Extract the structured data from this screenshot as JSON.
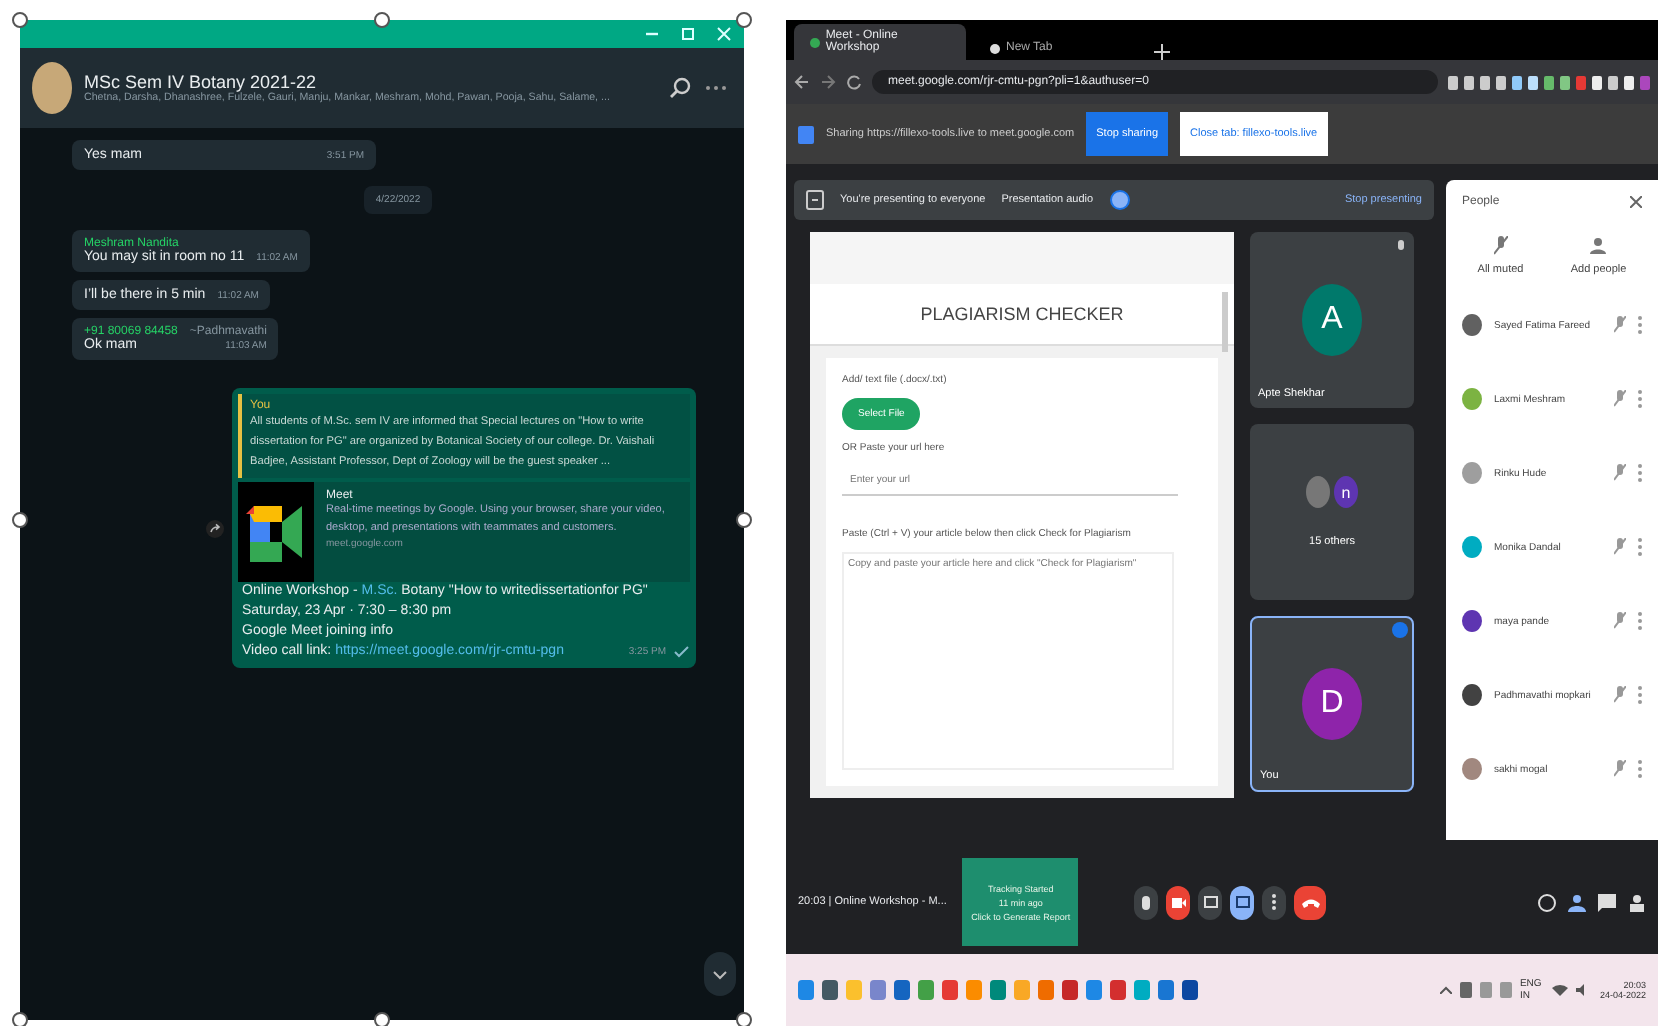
{
  "chat": {
    "group_name": "MSc Sem IV Botany 2021-22",
    "members": "Chetna, Darsha, Dhanashree, Fulzele, Gauri, Manju, Mankar, Meshram, Mohd, Pawan, Pooja, Sahu, Salame, ...",
    "messages": [
      {
        "kind": "incoming",
        "text": "Yes mam",
        "time": "3:51 PM"
      },
      {
        "kind": "date",
        "text": "4/22/2022"
      },
      {
        "kind": "incoming",
        "sender": "Meshram Nandita",
        "text": "You may sit in room no 11",
        "time": "11:02 AM"
      },
      {
        "kind": "incoming",
        "text": "I’ll be there in 5 min",
        "time": "11:02 AM"
      },
      {
        "kind": "incoming",
        "sender": "+91 80069 84458",
        "sender_note": "~Padhmavathi",
        "text": "Ok mam",
        "time": "11:03 AM"
      },
      {
        "kind": "outgoing",
        "quote_author": "You",
        "quote_text": "All students of M.Sc. sem IV are informed  that Special lectures on \"How to write dissertation for PG\" are organized by Botanical Society of our college. Dr. Vaishali Badjee, Assistant Professor,  Dept of Zoology will be the guest speaker ...",
        "preview_title": "Meet",
        "preview_text": "Real-time meetings by Google. Using your browser, share your video, desktop, and presentations with teammates and customers.",
        "preview_site": "meet.google.com",
        "title_start": "Online Workshop - ",
        "title_link": "M.Sc.",
        "title_end": " Botany \"How to writedissertationfor PG\"",
        "lines": [
          "Saturday, 23 Apr · 7:30 – 8:30 pm",
          "Google Meet joining info"
        ],
        "link_label": "Video call link: ",
        "link": "https://meet.google.com/rjr-cmtu-pgn",
        "time": "3:25 PM"
      }
    ]
  },
  "browser": {
    "tabs": [
      {
        "label": "Meet - Online Workshop",
        "selected": true
      },
      {
        "label": "New Tab",
        "selected": false
      }
    ],
    "address": "meet.google.com/rjr-cmtu-pgn?pli=1&authuser=0",
    "sharing_text": "Sharing https://fillexo-tools.live to meet.google.com",
    "stop_sharing": "Stop sharing",
    "switch_tab": "Close tab: fillexo-tools.live"
  },
  "meet": {
    "presenting": "You're presenting to everyone",
    "presentation_audio": "Presentation audio",
    "audio_on": true,
    "stop_presenting": "Stop presenting",
    "shared": {
      "title": "PLAGIARISM CHECKER",
      "upload_label": "Add/ text file (.docx/.txt)",
      "select_file": "Select File",
      "url_label": "OR Paste your url here",
      "url_placeholder": "Enter your url",
      "paste_label": "Paste (Ctrl + V) your article below then click Check for Plagiarism",
      "text_placeholder": "Copy and paste your article here and click \"Check for Plagiarism\""
    },
    "tiles": [
      {
        "kind": "person",
        "initial": "A",
        "name": "Apte Shekhar",
        "color": "#00796b"
      },
      {
        "kind": "group",
        "initial": "n",
        "name": "15 others",
        "color": "#5e35b1"
      },
      {
        "kind": "self",
        "initial": "D",
        "name": "You",
        "color": "#8e24aa"
      }
    ],
    "people": {
      "title": "People",
      "actions": [
        "All muted",
        "Add people"
      ],
      "participants": [
        {
          "name": "Sayed Fatima Fareed",
          "color": "#616161"
        },
        {
          "name": "Laxmi Meshram",
          "color": "#7cb342"
        },
        {
          "name": "Rinku Hude",
          "color": "#9e9e9e"
        },
        {
          "name": "Monika Dandal",
          "color": "#00acc1"
        },
        {
          "name": "maya pande",
          "color": "#5e35b1"
        },
        {
          "name": "Padhmavathi mopkari",
          "color": "#424242"
        },
        {
          "name": "sakhi mogal",
          "color": "#a1887f"
        }
      ]
    },
    "meeting_info": "20:03  |  Online Workshop - M...",
    "toast": [
      "Tracking Started",
      "11 min ago",
      "Click to Generate Report"
    ]
  },
  "taskbar": {
    "language": "ENG IN",
    "time": "20:03",
    "date": "24-04-2022"
  }
}
